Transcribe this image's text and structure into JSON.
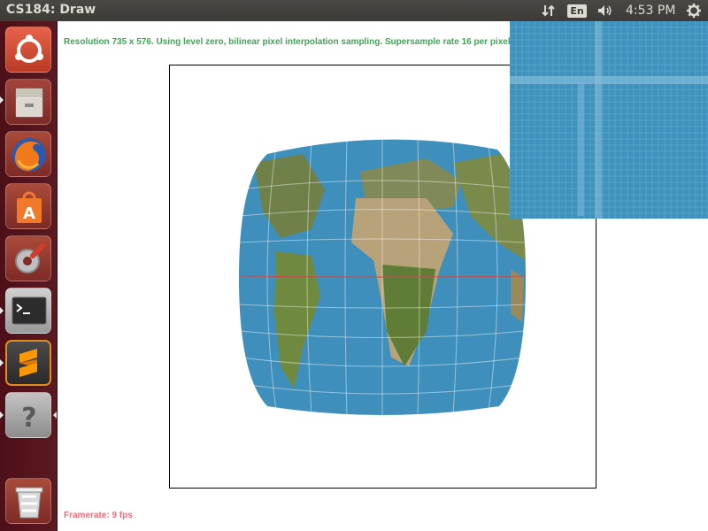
{
  "window": {
    "title": "CS184: Draw"
  },
  "panel": {
    "language": "En",
    "clock": "4:53 PM",
    "icons": [
      "network-arrows-icon",
      "language-icon",
      "volume-icon",
      "power-gear-icon"
    ]
  },
  "launcher": {
    "items": [
      {
        "name": "ubuntu-dash-icon",
        "running": false
      },
      {
        "name": "files-icon",
        "running": true
      },
      {
        "name": "firefox-icon",
        "running": false
      },
      {
        "name": "software-center-icon",
        "running": false
      },
      {
        "name": "system-settings-icon",
        "running": false
      },
      {
        "name": "terminal-icon",
        "running": true
      },
      {
        "name": "sublime-text-icon",
        "running": true
      },
      {
        "name": "unknown-app-icon",
        "running": true,
        "focused": true
      },
      {
        "name": "trash-icon",
        "running": false
      }
    ]
  },
  "content": {
    "status_text": "Resolution 735 x 576. Using level zero, bilinear pixel interpolation sampling. Supersample rate 16 per pixel.",
    "framerate": "Framerate: 9 fps"
  },
  "colors": {
    "status_green": "#3ea552",
    "framerate_pink": "#f06a78",
    "launcher_bg": "#5a1a20",
    "panel_bg": "#3c3b37",
    "ocean": "#3f8fbd",
    "land": "#7a8a4a"
  }
}
